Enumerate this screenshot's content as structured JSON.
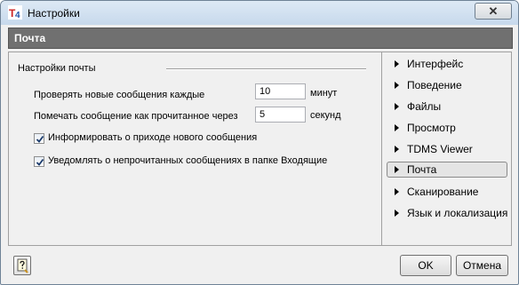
{
  "window": {
    "title": "Настройки",
    "close_label": "✕"
  },
  "header": {
    "title": "Почта"
  },
  "mail_settings": {
    "group_title": "Настройки почты",
    "check_interval": {
      "label": "Проверять новые сообщения каждые",
      "value": "10",
      "unit": "минут"
    },
    "mark_read": {
      "label": "Помечать сообщение как прочитанное через",
      "value": "5",
      "unit": "секунд"
    },
    "notify_new": {
      "label": "Информировать о приходе нового сообщения",
      "checked": true
    },
    "notify_unread": {
      "label": "Уведомлять о непрочитанных сообщениях в папке Входящие",
      "checked": true
    }
  },
  "nav": {
    "items": [
      {
        "label": "Интерфейс"
      },
      {
        "label": "Поведение"
      },
      {
        "label": "Файлы"
      },
      {
        "label": "Просмотр"
      },
      {
        "label": "TDMS Viewer"
      },
      {
        "label": "Почта",
        "active": true
      },
      {
        "label": "Сканирование"
      },
      {
        "label": "Язык и локализация"
      }
    ]
  },
  "footer": {
    "ok_label": "OK",
    "cancel_label": "Отмена"
  },
  "colors": {
    "header_bg": "#707070",
    "app_icon_red": "#cc2222",
    "app_icon_blue": "#2255aa"
  },
  "icons": {
    "app": "tdms-app-icon",
    "help": "help-icon",
    "close": "close-icon",
    "nav_arrow": "triangle-right-icon"
  }
}
